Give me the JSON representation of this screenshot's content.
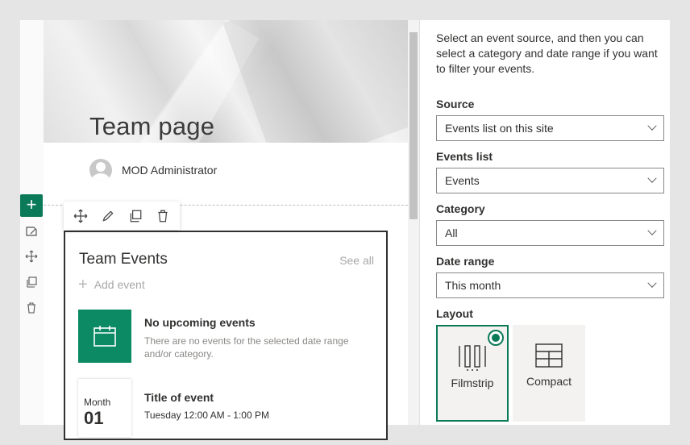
{
  "page": {
    "title": "Team page",
    "author": "MOD Administrator"
  },
  "events_webpart": {
    "title": "Team Events",
    "see_all": "See all",
    "add_event": "Add event",
    "no_events_title": "No upcoming events",
    "no_events_desc": "There are no events for the selected date range and/or category.",
    "sample_event": {
      "month": "Month",
      "day": "01",
      "title": "Title of event",
      "time": "Tuesday 12:00 AM - 1:00 PM"
    }
  },
  "toolbar_icons": [
    "move-icon",
    "edit-icon",
    "duplicate-icon",
    "delete-icon"
  ],
  "property_pane": {
    "description": "Select an event source, and then you can select a category and date range if you want to filter your events.",
    "source": {
      "label": "Source",
      "value": "Events list on this site"
    },
    "events_list": {
      "label": "Events list",
      "value": "Events"
    },
    "category": {
      "label": "Category",
      "value": "All"
    },
    "date_range": {
      "label": "Date range",
      "value": "This month"
    },
    "layout": {
      "label": "Layout",
      "options": [
        {
          "label": "Filmstrip",
          "selected": true
        },
        {
          "label": "Compact",
          "selected": false
        }
      ]
    }
  },
  "colors": {
    "accent": "#0b7a58",
    "tile": "#0b8a64"
  }
}
